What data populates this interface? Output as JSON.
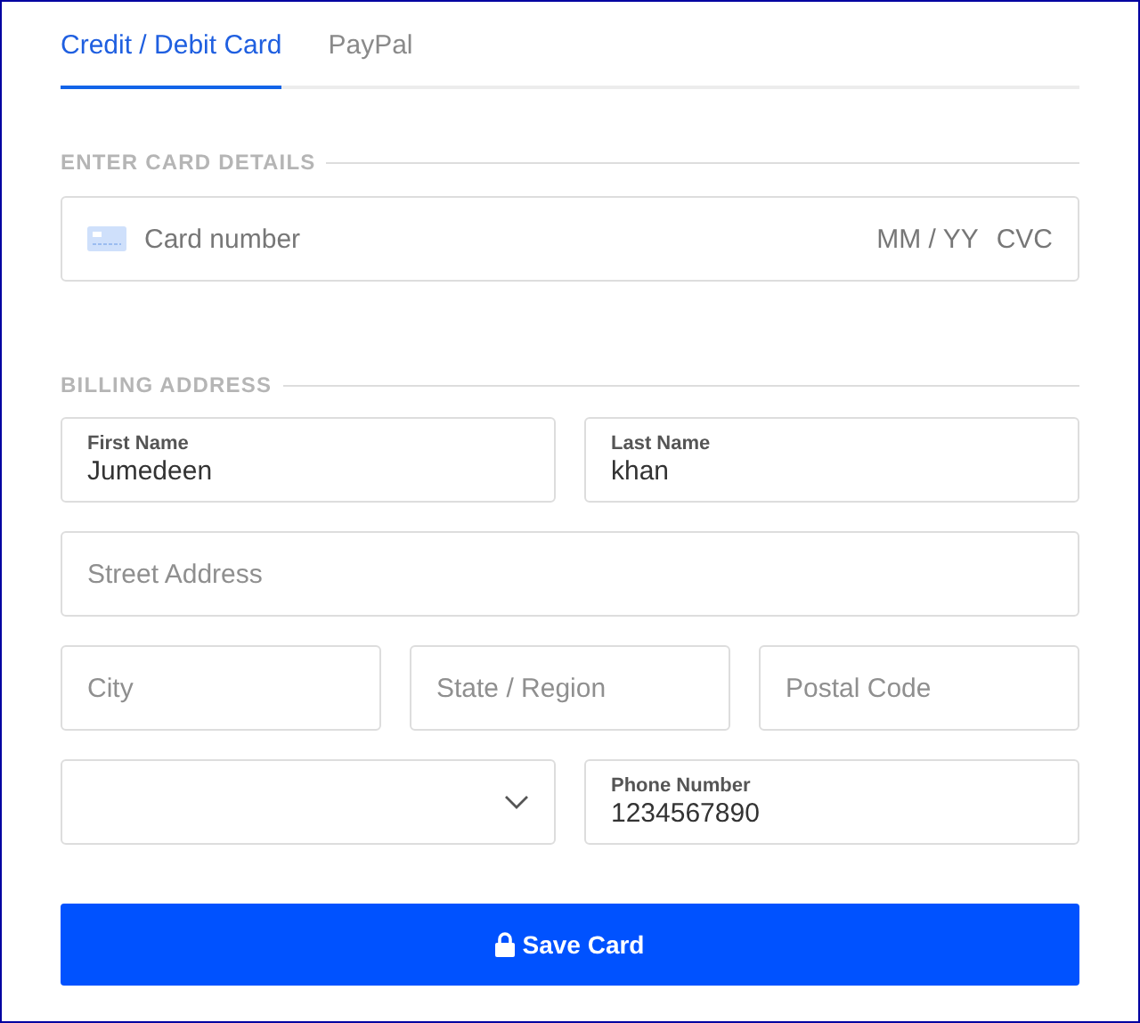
{
  "tabs": [
    {
      "label": "Credit / Debit Card",
      "selected": true
    },
    {
      "label": "PayPal",
      "selected": false
    }
  ],
  "card_section": {
    "title": "ENTER CARD DETAILS",
    "card_placeholder": "Card number",
    "expiry_placeholder": "MM / YY",
    "cvc_placeholder": "CVC"
  },
  "billing": {
    "title": "BILLING ADDRESS",
    "rows": [
      [
        {
          "kind": "labeled",
          "label": "First Name",
          "value": "Jumedeen"
        },
        {
          "kind": "labeled",
          "label": "Last Name",
          "value": "khan"
        }
      ],
      [
        {
          "kind": "text",
          "placeholder": "Street Address"
        }
      ],
      [
        {
          "kind": "text",
          "placeholder": "City"
        },
        {
          "kind": "text",
          "placeholder": "State / Region"
        },
        {
          "kind": "text",
          "placeholder": "Postal Code"
        }
      ],
      [
        {
          "kind": "select"
        },
        {
          "kind": "labeled",
          "label": "Phone Number",
          "value": "1234567890"
        }
      ]
    ]
  },
  "save_button": {
    "label": "Save Card"
  }
}
